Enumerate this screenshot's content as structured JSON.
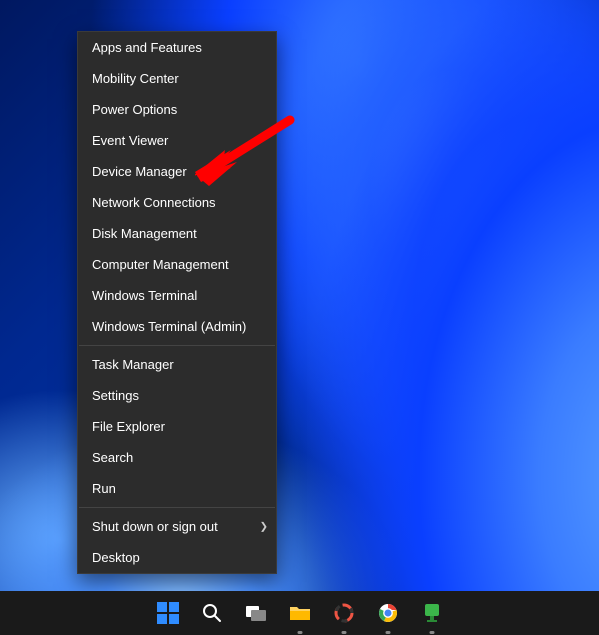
{
  "menu": {
    "groups": [
      [
        "Apps and Features",
        "Mobility Center",
        "Power Options",
        "Event Viewer",
        "Device Manager",
        "Network Connections",
        "Disk Management",
        "Computer Management",
        "Windows Terminal",
        "Windows Terminal (Admin)"
      ],
      [
        "Task Manager",
        "Settings",
        "File Explorer",
        "Search",
        "Run"
      ],
      [
        "Shut down or sign out",
        "Desktop"
      ]
    ],
    "submenu_item": "Shut down or sign out",
    "highlighted_item": "Device Manager"
  },
  "taskbar": {
    "items": [
      {
        "id": "start",
        "label": "Start"
      },
      {
        "id": "search",
        "label": "Search"
      },
      {
        "id": "taskview",
        "label": "Task View"
      },
      {
        "id": "explorer",
        "label": "File Explorer"
      },
      {
        "id": "app1",
        "label": "App"
      },
      {
        "id": "chrome",
        "label": "Chrome"
      },
      {
        "id": "app2",
        "label": "App"
      }
    ]
  },
  "colors": {
    "menu_bg": "#2c2c2c",
    "menu_text": "#ffffff",
    "taskbar_bg": "#1a1a1a",
    "annotation": "#ff0000"
  }
}
